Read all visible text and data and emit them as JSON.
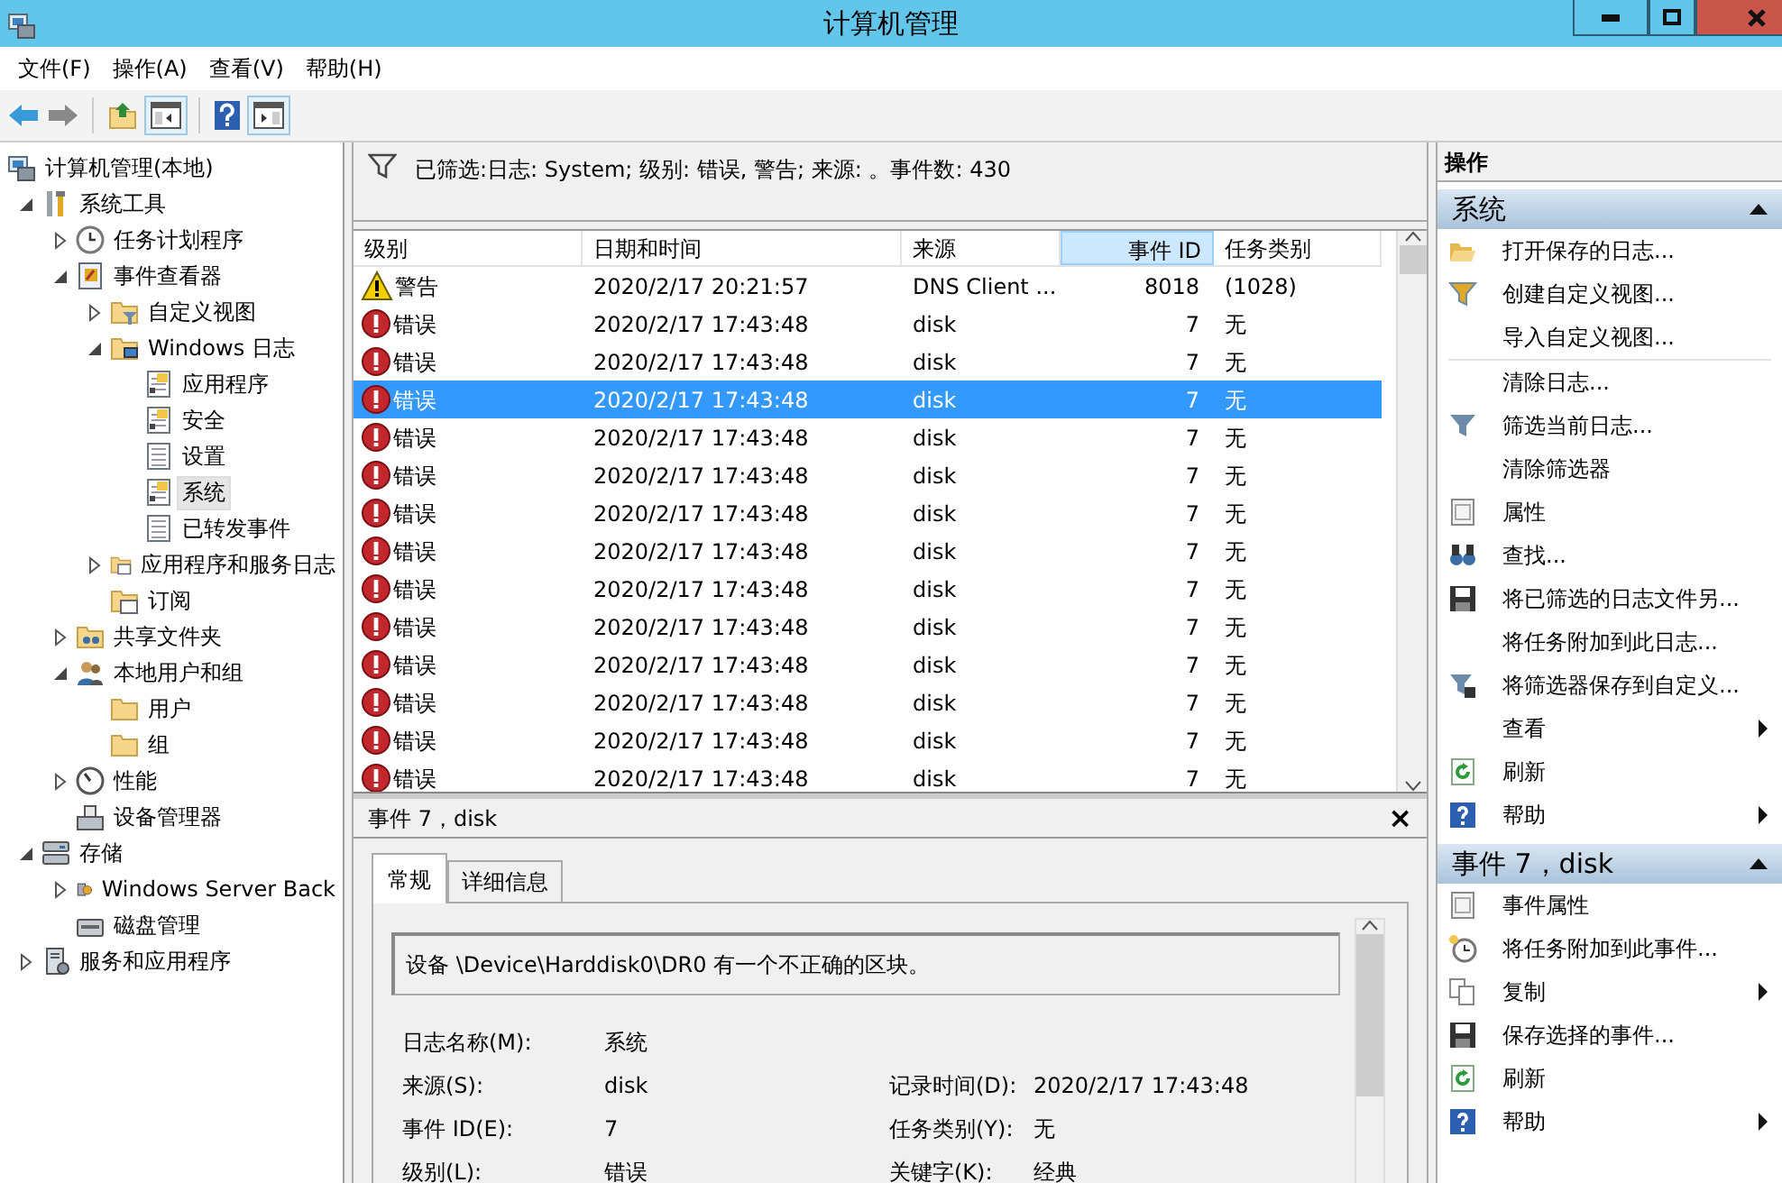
{
  "window": {
    "title": "计算机管理"
  },
  "menu": [
    "文件(F)",
    "操作(A)",
    "查看(V)",
    "帮助(H)"
  ],
  "tree": [
    {
      "label": "计算机管理(本地)",
      "selected": false,
      "children": [
        {
          "label": "系统工具",
          "expanded": true,
          "selected": false,
          "children": [
            {
              "label": "任务计划程序",
              "expanded": false,
              "selected": false
            },
            {
              "label": "事件查看器",
              "expanded": true,
              "selected": false,
              "children": [
                {
                  "label": "自定义视图",
                  "expanded": false,
                  "selected": false
                },
                {
                  "label": "Windows 日志",
                  "expanded": true,
                  "selected": false,
                  "children": [
                    {
                      "label": "应用程序",
                      "selected": false
                    },
                    {
                      "label": "安全",
                      "selected": false
                    },
                    {
                      "label": "设置",
                      "selected": false
                    },
                    {
                      "label": "系统",
                      "selected": true
                    },
                    {
                      "label": "已转发事件",
                      "selected": false
                    }
                  ]
                },
                {
                  "label": "应用程序和服务日志",
                  "expanded": false,
                  "selected": false
                },
                {
                  "label": "订阅",
                  "selected": false
                }
              ]
            },
            {
              "label": "共享文件夹",
              "expanded": false,
              "selected": false
            },
            {
              "label": "本地用户和组",
              "expanded": true,
              "selected": false,
              "children": [
                {
                  "label": "用户",
                  "selected": false
                },
                {
                  "label": "组",
                  "selected": false
                }
              ]
            },
            {
              "label": "性能",
              "expanded": false,
              "selected": false
            },
            {
              "label": "设备管理器",
              "selected": false
            }
          ]
        },
        {
          "label": "存储",
          "expanded": true,
          "selected": false,
          "children": [
            {
              "label": "Windows Server Back",
              "expanded": false,
              "selected": false
            },
            {
              "label": "磁盘管理",
              "selected": false
            }
          ]
        },
        {
          "label": "服务和应用程序",
          "expanded": false,
          "selected": false
        }
      ]
    }
  ],
  "filter_text": "已筛选:日志: System; 级别: 错误, 警告; 来源: 。事件数: 430",
  "table": {
    "columns": [
      {
        "label": "级别",
        "highlighted": false
      },
      {
        "label": "日期和时间",
        "highlighted": false
      },
      {
        "label": "来源",
        "highlighted": false
      },
      {
        "label": "事件 ID",
        "highlighted": true
      },
      {
        "label": "任务类别",
        "highlighted": false
      }
    ],
    "rows": [
      {
        "kind": "warning",
        "level": "警告",
        "date": "2020/2/17 20:21:57",
        "source": "DNS Client ...",
        "event_id": "8018",
        "category": "(1028)",
        "selected": false
      },
      {
        "kind": "error",
        "level": "错误",
        "date": "2020/2/17 17:43:48",
        "source": "disk",
        "event_id": "7",
        "category": "无",
        "selected": false
      },
      {
        "kind": "error",
        "level": "错误",
        "date": "2020/2/17 17:43:48",
        "source": "disk",
        "event_id": "7",
        "category": "无",
        "selected": false
      },
      {
        "kind": "error",
        "level": "错误",
        "date": "2020/2/17 17:43:48",
        "source": "disk",
        "event_id": "7",
        "category": "无",
        "selected": true
      },
      {
        "kind": "error",
        "level": "错误",
        "date": "2020/2/17 17:43:48",
        "source": "disk",
        "event_id": "7",
        "category": "无",
        "selected": false
      },
      {
        "kind": "error",
        "level": "错误",
        "date": "2020/2/17 17:43:48",
        "source": "disk",
        "event_id": "7",
        "category": "无",
        "selected": false
      },
      {
        "kind": "error",
        "level": "错误",
        "date": "2020/2/17 17:43:48",
        "source": "disk",
        "event_id": "7",
        "category": "无",
        "selected": false
      },
      {
        "kind": "error",
        "level": "错误",
        "date": "2020/2/17 17:43:48",
        "source": "disk",
        "event_id": "7",
        "category": "无",
        "selected": false
      },
      {
        "kind": "error",
        "level": "错误",
        "date": "2020/2/17 17:43:48",
        "source": "disk",
        "event_id": "7",
        "category": "无",
        "selected": false
      },
      {
        "kind": "error",
        "level": "错误",
        "date": "2020/2/17 17:43:48",
        "source": "disk",
        "event_id": "7",
        "category": "无",
        "selected": false
      },
      {
        "kind": "error",
        "level": "错误",
        "date": "2020/2/17 17:43:48",
        "source": "disk",
        "event_id": "7",
        "category": "无",
        "selected": false
      },
      {
        "kind": "error",
        "level": "错误",
        "date": "2020/2/17 17:43:48",
        "source": "disk",
        "event_id": "7",
        "category": "无",
        "selected": false
      },
      {
        "kind": "error",
        "level": "错误",
        "date": "2020/2/17 17:43:48",
        "source": "disk",
        "event_id": "7",
        "category": "无",
        "selected": false
      },
      {
        "kind": "error",
        "level": "错误",
        "date": "2020/2/17 17:43:48",
        "source": "disk",
        "event_id": "7",
        "category": "无",
        "selected": false
      }
    ]
  },
  "detail": {
    "title": "事件 7，disk",
    "close": "×",
    "tabs": [
      {
        "label": "常规",
        "selected": true
      },
      {
        "label": "详细信息",
        "selected": false
      }
    ],
    "message": "设备 \\Device\\Harddisk0\\DR0 有一个不正确的区块。",
    "fields": [
      {
        "left": {
          "label": "日志名称(M):",
          "value": "系统"
        }
      },
      {
        "left": {
          "label": "来源(S):",
          "value": "disk"
        },
        "right": {
          "label": "记录时间(D):",
          "value": "2020/2/17 17:43:48"
        }
      },
      {
        "left": {
          "label": "事件 ID(E):",
          "value": "7"
        },
        "right": {
          "label": "任务类别(Y):",
          "value": "无"
        }
      },
      {
        "left": {
          "label": "级别(L):",
          "value": "错误"
        },
        "right": {
          "label": "关键字(K):",
          "value": "经典"
        }
      }
    ]
  },
  "actions": {
    "title": "操作",
    "sections": [
      {
        "title": "系统",
        "items": [
          {
            "label": "打开保存的日志...",
            "submenu": false
          },
          {
            "label": "创建自定义视图...",
            "submenu": false
          },
          {
            "label": "导入自定义视图...",
            "submenu": false
          },
          {
            "label": "清除日志...",
            "submenu": false
          },
          {
            "label": "筛选当前日志...",
            "submenu": false
          },
          {
            "label": "清除筛选器",
            "submenu": false
          },
          {
            "label": "属性",
            "submenu": false
          },
          {
            "label": "查找...",
            "submenu": false
          },
          {
            "label": "将已筛选的日志文件另...",
            "submenu": false
          },
          {
            "label": "将任务附加到此日志...",
            "submenu": false
          },
          {
            "label": "将筛选器保存到自定义...",
            "submenu": false
          },
          {
            "label": "查看",
            "submenu": true
          },
          {
            "label": "刷新",
            "submenu": false
          },
          {
            "label": "帮助",
            "submenu": true
          }
        ]
      },
      {
        "title": "事件 7，disk",
        "items": [
          {
            "label": "事件属性",
            "submenu": false
          },
          {
            "label": "将任务附加到此事件...",
            "submenu": false
          },
          {
            "label": "复制",
            "submenu": true
          },
          {
            "label": "保存选择的事件...",
            "submenu": false
          },
          {
            "label": "刷新",
            "submenu": false
          },
          {
            "label": "帮助",
            "submenu": true
          }
        ]
      }
    ]
  }
}
